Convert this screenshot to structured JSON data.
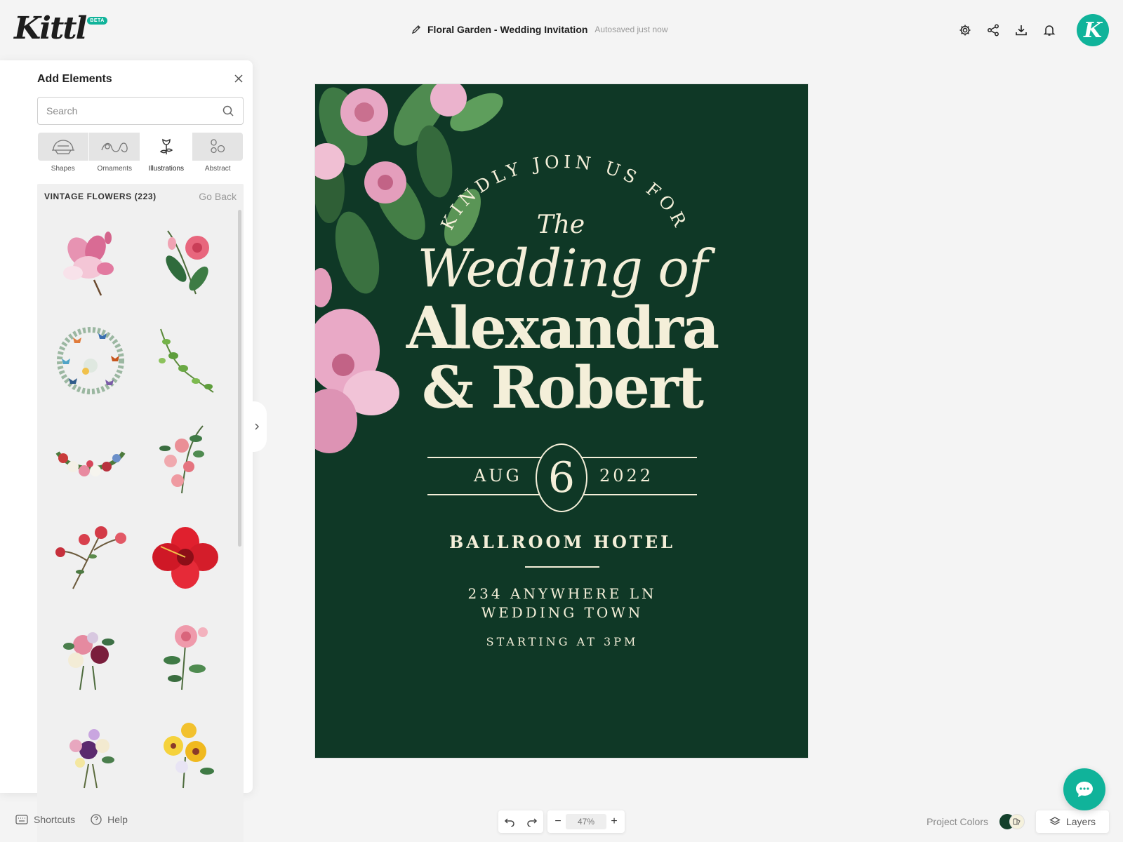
{
  "app": {
    "logo_text": "Kittl",
    "badge": "BETA",
    "accent_color": "#10b39a"
  },
  "document": {
    "title": "Floral Garden - Wedding Invitation",
    "save_status": "Autosaved just now"
  },
  "top_actions": [
    "gear-icon",
    "share-icon",
    "download-icon",
    "bell-icon"
  ],
  "user": {
    "avatar_letter": "K"
  },
  "rail": [
    "edit-icon",
    "templates-icon",
    "text-icon",
    "elements-icon",
    "upload-icon",
    "camera-icon",
    "grid-icon"
  ],
  "panel": {
    "title": "Add Elements",
    "search_placeholder": "Search",
    "categories": [
      {
        "label": "Shapes",
        "icon": "shapes-icon"
      },
      {
        "label": "Ornaments",
        "icon": "ornaments-icon"
      },
      {
        "label": "Illustrations",
        "icon": "illustrations-icon",
        "active": true
      },
      {
        "label": "Abstract",
        "icon": "abstract-icon"
      }
    ],
    "section_title": "VINTAGE FLOWERS (223)",
    "go_back": "Go Back",
    "items": [
      "pink-magnolia",
      "pink-camellia-branch",
      "butterfly-wreath",
      "ivy-vine",
      "flower-garland",
      "pink-rose-branch",
      "red-rose-sprig",
      "red-hibiscus",
      "rose-bouquet",
      "pink-rose-stem",
      "purple-bouquet",
      "yellow-pansies"
    ]
  },
  "artboard": {
    "background": "#0f3826",
    "ink": "#f4efd9",
    "arc_text": "KINDLY JOIN US FOR",
    "the": "The",
    "wedding_of": "Wedding of",
    "names_line1": "Alexandra",
    "names_line2": "& Robert",
    "month": "AUG",
    "day": "6",
    "year": "2022",
    "venue": "BALLROOM HOTEL",
    "address_line1": "234 ANYWHERE LN",
    "address_line2": "WEDDING TOWN",
    "time": "STARTING AT 3PM"
  },
  "bottom": {
    "shortcuts": "Shortcuts",
    "help": "Help",
    "zoom": "47%",
    "project_colors": "Project Colors",
    "layers": "Layers"
  }
}
